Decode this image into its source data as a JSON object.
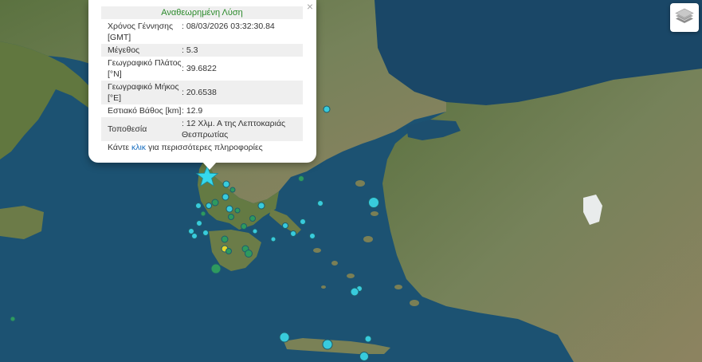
{
  "popup": {
    "title": "Αναθεωρημένη Λύση",
    "close": "×",
    "rows": [
      {
        "label": "Χρόνος Γέννησης [GMT]",
        "value": ": 08/03/2026 03:32:30.84"
      },
      {
        "label": "Μέγεθος",
        "value": ": 5.3"
      },
      {
        "label": "Γεωγραφικό Πλάτος [°N]",
        "value": ": 39.6822"
      },
      {
        "label": "Γεωγραφικό Μήκος [°E]",
        "value": ": 20.6538"
      },
      {
        "label": "Εστιακό Βάθος [km]",
        "value": ": 12.9"
      },
      {
        "label": "Τοποθεσία",
        "value": ": 12 Χλμ. Α της Λεπτοκαριάς Θεσπρωτίας"
      }
    ],
    "more_prefix": "Κάντε ",
    "more_link": "κλικ",
    "more_suffix": " για περισσότερες πληροφορίες"
  },
  "layers_button": {
    "icon": "layers-icon"
  },
  "colors": {
    "sea": "#1c5272",
    "land": "#6a7e4a",
    "quake_recent": "#38cbdc",
    "quake_older": "#2e9a5e",
    "quake_oldest": "#e6d62a",
    "star": "#35d8ec"
  }
}
